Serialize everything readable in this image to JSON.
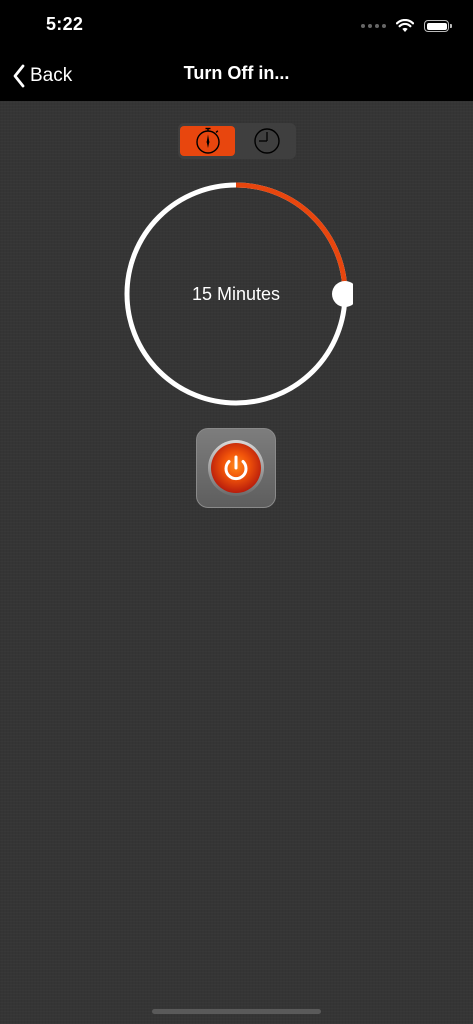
{
  "status_bar": {
    "time": "5:22"
  },
  "nav": {
    "back_label": "Back",
    "title": "Turn Off in..."
  },
  "mode_selector": {
    "items": [
      {
        "icon": "stopwatch-icon",
        "selected": true
      },
      {
        "icon": "clock-icon",
        "selected": false
      }
    ]
  },
  "timer": {
    "label": "15 Minutes",
    "progress_fraction": 0.25
  },
  "colors": {
    "accent": "#e8460e",
    "background": "#353535",
    "dial_track": "#ffffff"
  }
}
